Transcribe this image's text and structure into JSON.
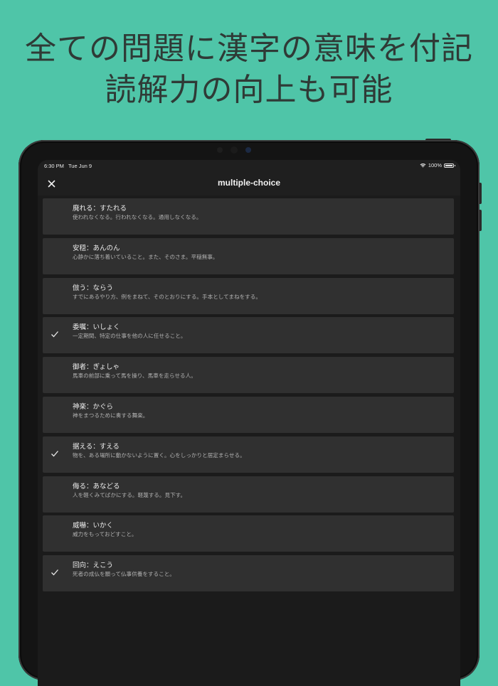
{
  "headline": {
    "line1": "全ての問題に漢字の意味を付記",
    "line2": "読解力の向上も可能"
  },
  "status_bar": {
    "time": "6:30 PM",
    "date": "Tue Jun 9",
    "battery": "100%"
  },
  "nav": {
    "title": "multiple-choice",
    "close_icon": "close-icon"
  },
  "colors": {
    "background": "#4fc5a8",
    "headline_text": "#2f3a36",
    "screen_bg": "#1b1b1b",
    "item_bg": "#303030"
  },
  "items": [
    {
      "term": "廃れる：すたれる",
      "meaning": "使われなくなる。行われなくなる。通用しなくなる。",
      "checked": false
    },
    {
      "term": "安穏：あんのん",
      "meaning": "心静かに落ち着いていること。また、そのさま。平穏無事。",
      "checked": false
    },
    {
      "term": "倣う：ならう",
      "meaning": "すでにあるやり方、例をまねて、そのとおりにする。手本としてまねをする。",
      "checked": false
    },
    {
      "term": "委嘱：いしょく",
      "meaning": "一定期間、特定の仕事を他の人に任せること。",
      "checked": true
    },
    {
      "term": "御者：ぎょしゃ",
      "meaning": "馬車の前部に乗って馬を操り、馬車を走らせる人。",
      "checked": false
    },
    {
      "term": "神楽：かぐら",
      "meaning": "神をまつるために奏する舞楽。",
      "checked": false
    },
    {
      "term": "据える：すえる",
      "meaning": "物を、ある場所に動かないように置く。心をしっかりと居定まらせる。",
      "checked": true
    },
    {
      "term": "侮る：あなどる",
      "meaning": "人を軽くみてばかにする。軽蔑する。見下す。",
      "checked": false
    },
    {
      "term": "威嚇：いかく",
      "meaning": "威力をもっておどすこと。",
      "checked": false
    },
    {
      "term": "回向：えこう",
      "meaning": "死者の成仏を願って仏事供養をすること。",
      "checked": true
    }
  ]
}
